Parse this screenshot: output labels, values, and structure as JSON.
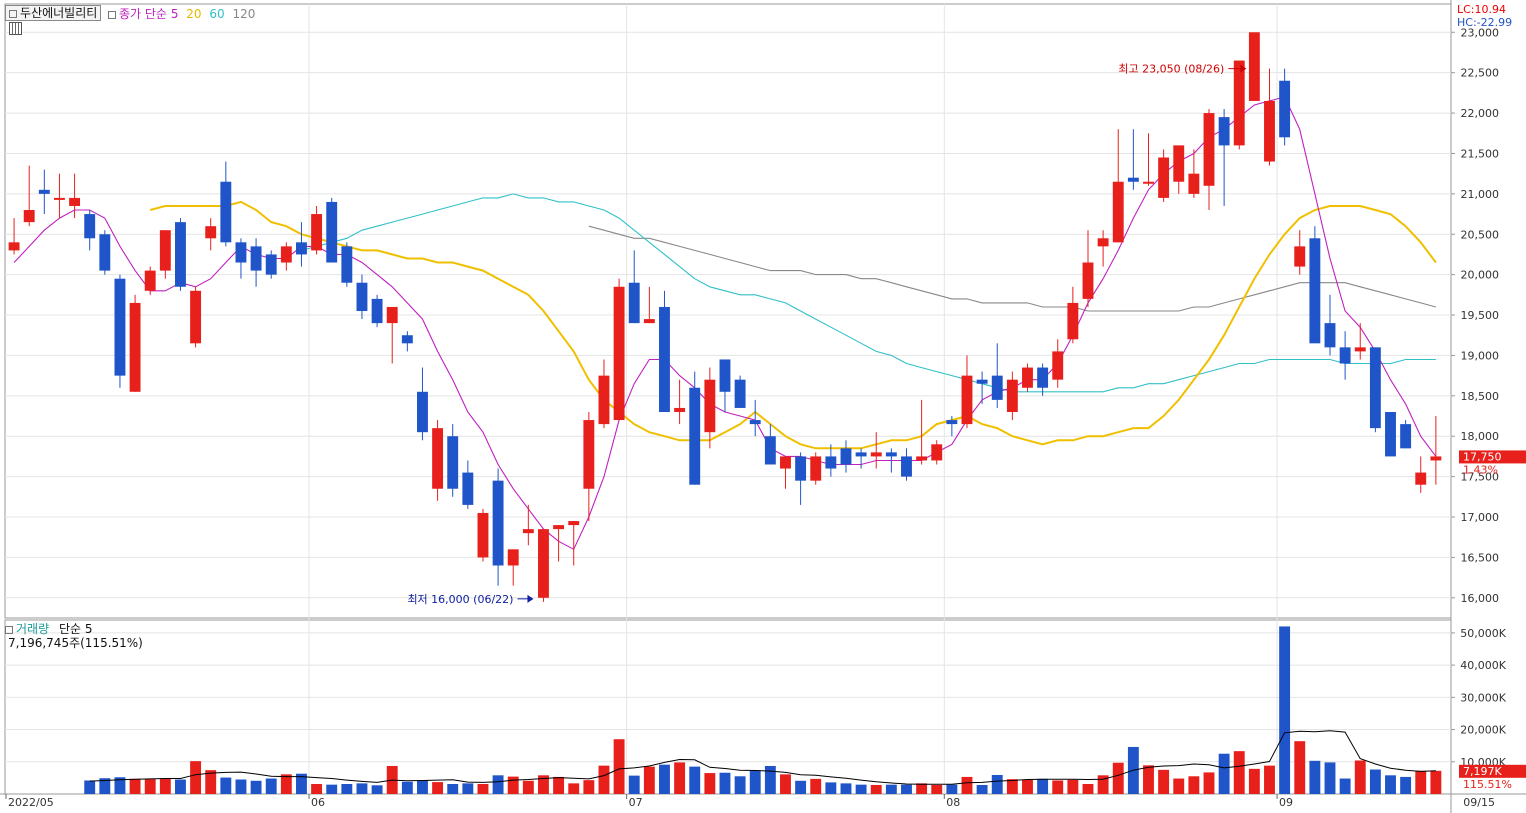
{
  "header": {
    "stock_name": "두산에너빌리티",
    "indicator_title": "종가 단순",
    "ma_periods": [
      "5",
      "20",
      "60",
      "120"
    ],
    "lc_label": "LC:10.94",
    "hc_label": "HC:-22.99"
  },
  "volume_header": {
    "title": "거래량",
    "ma_label": "단순 5",
    "summary": "7,196,745주(115.51%)"
  },
  "colors": {
    "up": "#e8201c",
    "down": "#1f55c8",
    "ma5": "#c020c0",
    "ma20": "#f0c000",
    "ma60": "#30c0c8",
    "ma120": "#888888",
    "volume_ma": "#000000",
    "grid": "#e4e4e4",
    "axis_text": "#333333"
  },
  "chart_data": {
    "type": "candlestick",
    "x_labels": [
      "2022/05",
      "06",
      "07",
      "08",
      "09",
      "09/15"
    ],
    "price_axis_ticks": [
      "23,000",
      "22,500",
      "22,000",
      "21,500",
      "21,000",
      "20,500",
      "20,000",
      "19,500",
      "19,000",
      "18,500",
      "18,000",
      "17,500",
      "17,000",
      "16,500",
      "16,000"
    ],
    "volume_axis_ticks": [
      "50,000K",
      "40,000K",
      "30,000K",
      "20,000K",
      "10,000K"
    ],
    "ylim_price": [
      15750,
      23350
    ],
    "ylim_volume": [
      0,
      54000
    ],
    "candles": [
      {
        "o": 20300,
        "h": 20700,
        "l": 20250,
        "c": 20400
      },
      {
        "o": 20650,
        "h": 21350,
        "l": 20600,
        "c": 20800
      },
      {
        "o": 21050,
        "h": 21300,
        "l": 20750,
        "c": 21000
      },
      {
        "o": 20950,
        "h": 21250,
        "l": 20700,
        "c": 20950
      },
      {
        "o": 20850,
        "h": 21250,
        "l": 20700,
        "c": 20950
      },
      {
        "o": 20750,
        "h": 20800,
        "l": 20300,
        "c": 20450
      },
      {
        "o": 20500,
        "h": 20550,
        "l": 20000,
        "c": 20050
      },
      {
        "o": 19950,
        "h": 20000,
        "l": 18600,
        "c": 18750
      },
      {
        "o": 18550,
        "h": 19750,
        "l": 18550,
        "c": 19650
      },
      {
        "o": 19800,
        "h": 20100,
        "l": 19750,
        "c": 20050
      },
      {
        "o": 20050,
        "h": 20550,
        "l": 19950,
        "c": 20550
      },
      {
        "o": 20650,
        "h": 20700,
        "l": 19800,
        "c": 19850
      },
      {
        "o": 19150,
        "h": 19850,
        "l": 19100,
        "c": 19800
      },
      {
        "o": 20450,
        "h": 20700,
        "l": 20300,
        "c": 20600
      },
      {
        "o": 21150,
        "h": 21400,
        "l": 20350,
        "c": 20400
      },
      {
        "o": 20400,
        "h": 20450,
        "l": 19950,
        "c": 20150
      },
      {
        "o": 20350,
        "h": 20450,
        "l": 19850,
        "c": 20050
      },
      {
        "o": 20250,
        "h": 20300,
        "l": 19950,
        "c": 20000
      },
      {
        "o": 20150,
        "h": 20400,
        "l": 20050,
        "c": 20350
      },
      {
        "o": 20400,
        "h": 20650,
        "l": 20100,
        "c": 20250
      },
      {
        "o": 20300,
        "h": 20850,
        "l": 20250,
        "c": 20750
      },
      {
        "o": 20900,
        "h": 20950,
        "l": 20150,
        "c": 20150
      },
      {
        "o": 20350,
        "h": 20400,
        "l": 19850,
        "c": 19900
      },
      {
        "o": 19900,
        "h": 20000,
        "l": 19450,
        "c": 19550
      },
      {
        "o": 19700,
        "h": 19750,
        "l": 19350,
        "c": 19400
      },
      {
        "o": 19400,
        "h": 19600,
        "l": 18900,
        "c": 19600
      },
      {
        "o": 19250,
        "h": 19300,
        "l": 19050,
        "c": 19150
      },
      {
        "o": 18550,
        "h": 18850,
        "l": 17950,
        "c": 18050
      },
      {
        "o": 17350,
        "h": 18200,
        "l": 17200,
        "c": 18100
      },
      {
        "o": 18000,
        "h": 18150,
        "l": 17250,
        "c": 17350
      },
      {
        "o": 17550,
        "h": 17700,
        "l": 17100,
        "c": 17150
      },
      {
        "o": 16500,
        "h": 17100,
        "l": 16450,
        "c": 17050
      },
      {
        "o": 17450,
        "h": 17600,
        "l": 16150,
        "c": 16400
      },
      {
        "o": 16400,
        "h": 16600,
        "l": 16150,
        "c": 16600
      },
      {
        "o": 16800,
        "h": 17150,
        "l": 16650,
        "c": 16850
      },
      {
        "o": 16000,
        "h": 16850,
        "l": 15950,
        "c": 16850
      },
      {
        "o": 16850,
        "h": 16900,
        "l": 16450,
        "c": 16900
      },
      {
        "o": 16900,
        "h": 16950,
        "l": 16400,
        "c": 16950
      },
      {
        "o": 17350,
        "h": 18300,
        "l": 16950,
        "c": 18200
      },
      {
        "o": 18150,
        "h": 18950,
        "l": 18100,
        "c": 18750
      },
      {
        "o": 18200,
        "h": 19950,
        "l": 18200,
        "c": 19850
      },
      {
        "o": 19900,
        "h": 20300,
        "l": 19400,
        "c": 19400
      },
      {
        "o": 19400,
        "h": 19850,
        "l": 19400,
        "c": 19450
      },
      {
        "o": 19600,
        "h": 19800,
        "l": 18550,
        "c": 18300
      },
      {
        "o": 18300,
        "h": 18700,
        "l": 18150,
        "c": 18350
      },
      {
        "o": 18600,
        "h": 18800,
        "l": 17400,
        "c": 17400
      },
      {
        "o": 18050,
        "h": 18850,
        "l": 17850,
        "c": 18700
      },
      {
        "o": 18950,
        "h": 18950,
        "l": 18300,
        "c": 18550
      },
      {
        "o": 18700,
        "h": 18750,
        "l": 18350,
        "c": 18350
      },
      {
        "o": 18200,
        "h": 18450,
        "l": 18000,
        "c": 18150
      },
      {
        "o": 18000,
        "h": 18150,
        "l": 17650,
        "c": 17650
      },
      {
        "o": 17600,
        "h": 17700,
        "l": 17350,
        "c": 17750
      },
      {
        "o": 17750,
        "h": 17800,
        "l": 17150,
        "c": 17450
      },
      {
        "o": 17450,
        "h": 17800,
        "l": 17400,
        "c": 17750
      },
      {
        "o": 17750,
        "h": 17900,
        "l": 17500,
        "c": 17600
      },
      {
        "o": 17850,
        "h": 17950,
        "l": 17550,
        "c": 17650
      },
      {
        "o": 17800,
        "h": 17850,
        "l": 17600,
        "c": 17750
      },
      {
        "o": 17750,
        "h": 18050,
        "l": 17600,
        "c": 17800
      },
      {
        "o": 17800,
        "h": 17850,
        "l": 17550,
        "c": 17750
      },
      {
        "o": 17750,
        "h": 17850,
        "l": 17450,
        "c": 17500
      },
      {
        "o": 17700,
        "h": 18450,
        "l": 17650,
        "c": 17750
      },
      {
        "o": 17700,
        "h": 17950,
        "l": 17650,
        "c": 17900
      },
      {
        "o": 18200,
        "h": 18250,
        "l": 18000,
        "c": 18150
      },
      {
        "o": 18150,
        "h": 19000,
        "l": 18100,
        "c": 18750
      },
      {
        "o": 18700,
        "h": 18800,
        "l": 18400,
        "c": 18650
      },
      {
        "o": 18750,
        "h": 19150,
        "l": 18350,
        "c": 18450
      },
      {
        "o": 18300,
        "h": 18800,
        "l": 18200,
        "c": 18700
      },
      {
        "o": 18600,
        "h": 18900,
        "l": 18550,
        "c": 18850
      },
      {
        "o": 18850,
        "h": 18900,
        "l": 18500,
        "c": 18600
      },
      {
        "o": 18700,
        "h": 19200,
        "l": 18600,
        "c": 19050
      },
      {
        "o": 19200,
        "h": 19850,
        "l": 19150,
        "c": 19650
      },
      {
        "o": 19700,
        "h": 20550,
        "l": 19600,
        "c": 20150
      },
      {
        "o": 20350,
        "h": 20550,
        "l": 20100,
        "c": 20450
      },
      {
        "o": 20400,
        "h": 21800,
        "l": 20400,
        "c": 21150
      },
      {
        "o": 21200,
        "h": 21800,
        "l": 21050,
        "c": 21150
      },
      {
        "o": 21150,
        "h": 21750,
        "l": 21100,
        "c": 21150
      },
      {
        "o": 20950,
        "h": 21550,
        "l": 20900,
        "c": 21450
      },
      {
        "o": 21150,
        "h": 21600,
        "l": 21000,
        "c": 21600
      },
      {
        "o": 21000,
        "h": 21550,
        "l": 20950,
        "c": 21250
      },
      {
        "o": 21100,
        "h": 22050,
        "l": 20800,
        "c": 22000
      },
      {
        "o": 21950,
        "h": 22050,
        "l": 20850,
        "c": 21600
      },
      {
        "o": 21600,
        "h": 22250,
        "l": 21550,
        "c": 22650
      },
      {
        "o": 22150,
        "h": 22550,
        "l": 22150,
        "c": 23000
      },
      {
        "o": 21400,
        "h": 22550,
        "l": 21350,
        "c": 22150
      },
      {
        "o": 22400,
        "h": 22550,
        "l": 21600,
        "c": 21700
      },
      {
        "o": 20100,
        "h": 20550,
        "l": 20000,
        "c": 20350
      },
      {
        "o": 20450,
        "h": 20600,
        "l": 19150,
        "c": 19150
      },
      {
        "o": 19400,
        "h": 19750,
        "l": 19000,
        "c": 19100
      },
      {
        "o": 19100,
        "h": 19300,
        "l": 18700,
        "c": 18900
      },
      {
        "o": 19050,
        "h": 19400,
        "l": 18950,
        "c": 19100
      },
      {
        "o": 19100,
        "h": 19100,
        "l": 18050,
        "c": 18100
      },
      {
        "o": 18300,
        "h": 18300,
        "l": 17750,
        "c": 17750
      },
      {
        "o": 18150,
        "h": 18200,
        "l": 17850,
        "c": 17850
      },
      {
        "o": 17400,
        "h": 17750,
        "l": 17300,
        "c": 17550
      },
      {
        "o": 17700,
        "h": 18250,
        "l": 17400,
        "c": 17750
      }
    ],
    "ma5": [
      20150,
      20350,
      20550,
      20700,
      20800,
      20800,
      20700,
      20350,
      20050,
      19800,
      19800,
      19900,
      19850,
      19950,
      20150,
      20350,
      20250,
      20200,
      20200,
      20350,
      20350,
      20250,
      20250,
      20150,
      20000,
      19850,
      19650,
      19450,
      19050,
      18700,
      18300,
      18050,
      17650,
      17350,
      17100,
      16850,
      16700,
      16600,
      17000,
      17500,
      18200,
      18650,
      18950,
      18950,
      18750,
      18600,
      18400,
      18300,
      18250,
      18200,
      17850,
      17750,
      17750,
      17700,
      17650,
      17650,
      17650,
      17700,
      17700,
      17700,
      17700,
      17800,
      17900,
      18200,
      18450,
      18550,
      18600,
      18700,
      18700,
      18900,
      19250,
      19650,
      19950,
      20300,
      20700,
      21050,
      21250,
      21400,
      21500,
      21700,
      21800,
      21950,
      22100,
      22150,
      22200,
      21800,
      21000,
      20200,
      19550,
      19350,
      19050,
      18700,
      18400,
      18000,
      17750
    ],
    "ma20": [
      20800,
      20850,
      20850,
      20850,
      20850,
      20850,
      20900,
      20800,
      20650,
      20600,
      20500,
      20450,
      20400,
      20350,
      20300,
      20300,
      20250,
      20200,
      20200,
      20150,
      20150,
      20100,
      20050,
      19950,
      19850,
      19750,
      19550,
      19300,
      19050,
      18700,
      18450,
      18300,
      18150,
      18050,
      18000,
      17950,
      17950,
      17950,
      18050,
      18150,
      18300,
      18150,
      18000,
      17900,
      17850,
      17850,
      17850,
      17850,
      17900,
      17950,
      17950,
      18000,
      18150,
      18200,
      18250,
      18150,
      18100,
      18000,
      17950,
      17900,
      17950,
      17950,
      18000,
      18000,
      18050,
      18100,
      18100,
      18250,
      18450,
      18700,
      18950,
      19250,
      19600,
      19950,
      20250,
      20500,
      20700,
      20800,
      20850,
      20850,
      20850,
      20800,
      20750,
      20600,
      20400,
      20150
    ],
    "ma60": [
      20300,
      20350,
      20400,
      20450,
      20550,
      20600,
      20650,
      20700,
      20750,
      20800,
      20850,
      20900,
      20950,
      20950,
      21000,
      20950,
      20950,
      20900,
      20900,
      20850,
      20800,
      20700,
      20550,
      20400,
      20250,
      20100,
      19950,
      19850,
      19800,
      19750,
      19750,
      19700,
      19650,
      19550,
      19450,
      19350,
      19250,
      19150,
      19050,
      19000,
      18900,
      18850,
      18800,
      18750,
      18700,
      18650,
      18600,
      18550,
      18550,
      18550,
      18550,
      18550,
      18550,
      18550,
      18600,
      18600,
      18650,
      18650,
      18700,
      18750,
      18800,
      18850,
      18900,
      18900,
      18950,
      18950,
      18950,
      18950,
      18950,
      18900,
      18900,
      18900,
      18900,
      18950,
      18950,
      18950
    ],
    "ma120": [
      20600,
      20550,
      20500,
      20450,
      20450,
      20400,
      20350,
      20300,
      20250,
      20200,
      20150,
      20100,
      20050,
      20050,
      20050,
      20000,
      20000,
      20000,
      19950,
      19950,
      19900,
      19850,
      19800,
      19750,
      19700,
      19700,
      19650,
      19650,
      19650,
      19650,
      19600,
      19600,
      19600,
      19550,
      19550,
      19550,
      19550,
      19550,
      19550,
      19550,
      19600,
      19600,
      19650,
      19700,
      19750,
      19800,
      19850,
      19900,
      19900,
      19900,
      19900,
      19850,
      19800,
      19750,
      19700,
      19650,
      19600
    ],
    "volume": [
      4200,
      4900,
      5200,
      4700,
      4600,
      4800,
      4500,
      10200,
      7400,
      5100,
      4500,
      4100,
      4800,
      6100,
      6300,
      3100,
      2900,
      3100,
      3300,
      2700,
      8700,
      3800,
      4200,
      3700,
      3100,
      3300,
      3100,
      5800,
      5400,
      4100,
      5800,
      5300,
      3300,
      4300,
      8800,
      17000,
      5700,
      8500,
      9100,
      9800,
      8500,
      6500,
      6600,
      5500,
      7200,
      8700,
      6100,
      4100,
      4700,
      3600,
      3300,
      2900,
      2800,
      2900,
      2900,
      3300,
      2800,
      2900,
      5300,
      2800,
      5900,
      4600,
      4400,
      4700,
      4200,
      4400,
      3100,
      5800,
      9700,
      14600,
      8900,
      7500,
      4800,
      5500,
      6700,
      12500,
      13300,
      7800,
      8800,
      52000,
      16400,
      10300,
      9800,
      4800,
      10400,
      7600,
      5800,
      5300,
      7200,
      7200
    ],
    "volume_ma": [
      4000,
      4200,
      4400,
      4600,
      4700,
      4800,
      4800,
      6000,
      6500,
      6700,
      6800,
      6200,
      5500,
      5400,
      5400,
      5100,
      4800,
      4300,
      3900,
      3600,
      4300,
      4100,
      4200,
      4300,
      4400,
      3700,
      3600,
      3800,
      4300,
      4500,
      4800,
      5100,
      4900,
      4700,
      5700,
      7800,
      8100,
      8700,
      9800,
      10700,
      10600,
      8300,
      7900,
      7400,
      7300,
      7100,
      6700,
      6000,
      5800,
      5300,
      4900,
      4300,
      3800,
      3400,
      3100,
      3000,
      3000,
      3000,
      3500,
      3600,
      4000,
      4200,
      4500,
      4600,
      4600,
      4600,
      4500,
      4600,
      5800,
      7400,
      8300,
      8700,
      8800,
      9300,
      9100,
      8100,
      8600,
      9300,
      10100,
      19000,
      19500,
      19300,
      19600,
      19200,
      11000,
      9300,
      8000,
      7400,
      7000,
      7200
    ]
  },
  "annotations": {
    "high": "최고 23,050 (08/26)",
    "low": "최저 16,000 (06/22)",
    "last_price": "17,750",
    "last_change": "1.43%",
    "last_volume": "7,197K",
    "last_volume_pct": "115.51%"
  }
}
